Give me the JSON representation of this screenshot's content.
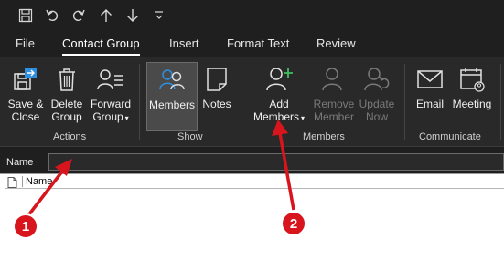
{
  "quick_access": {
    "icons": [
      "save-icon",
      "undo-icon",
      "redo-icon",
      "up-arrow-icon",
      "down-arrow-icon",
      "customize-icon"
    ]
  },
  "tabs": [
    {
      "label": "File"
    },
    {
      "label": "Contact Group",
      "active": true
    },
    {
      "label": "Insert"
    },
    {
      "label": "Format Text"
    },
    {
      "label": "Review"
    }
  ],
  "ribbon": {
    "actions": {
      "group_label": "Actions",
      "save_close": {
        "line1": "Save &",
        "line2": "Close"
      },
      "delete_group": {
        "line1": "Delete",
        "line2": "Group"
      },
      "forward_group": {
        "line1": "Forward",
        "line2": "Group"
      }
    },
    "show": {
      "group_label": "Show",
      "members": "Members",
      "notes": "Notes"
    },
    "members": {
      "group_label": "Members",
      "add_members": {
        "line1": "Add",
        "line2": "Members"
      },
      "remove_member": {
        "line1": "Remove",
        "line2": "Member"
      },
      "update_now": {
        "line1": "Update",
        "line2": "Now"
      }
    },
    "communicate": {
      "group_label": "Communicate",
      "email": "Email",
      "meeting": "Meeting"
    }
  },
  "name_field": {
    "label": "Name",
    "value": ""
  },
  "list": {
    "column_header": "Name"
  },
  "annotations": {
    "callout_1": "1",
    "callout_2": "2",
    "color": "#d8151c"
  },
  "colors": {
    "ribbon_bg": "#292929",
    "window_bg": "#1f1f1f",
    "accent_green": "#3fbf5f",
    "outlook_blue": "#2f8fdf"
  }
}
